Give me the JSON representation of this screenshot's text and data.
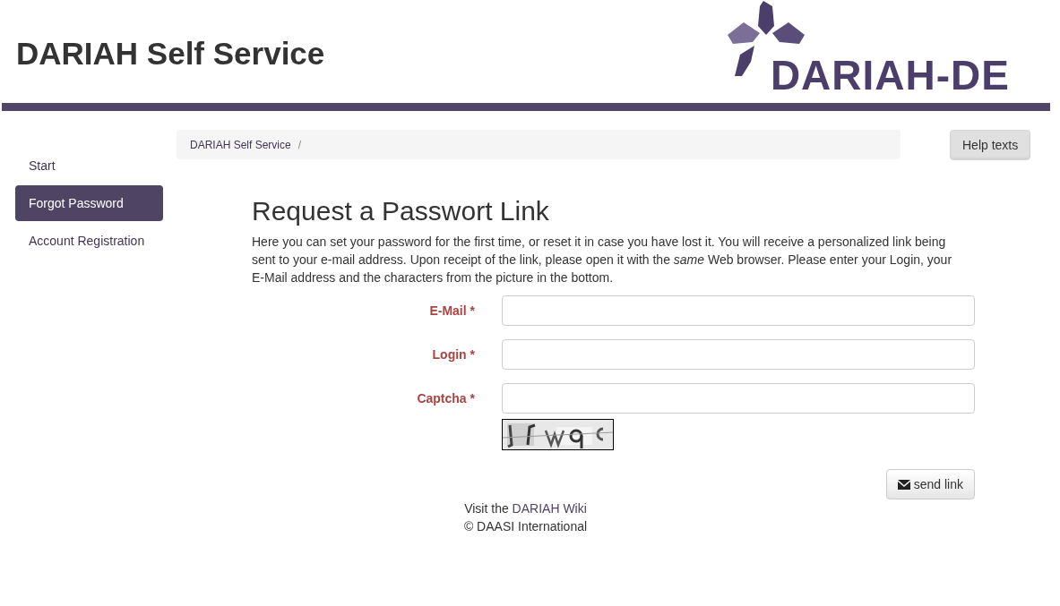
{
  "header": {
    "title": "DARIAH Self Service",
    "logo_text": "DARIAH-DE"
  },
  "sidebar": {
    "items": [
      {
        "label": "Start",
        "selected": false
      },
      {
        "label": "Forgot Password",
        "selected": true
      },
      {
        "label": "Account Registration",
        "selected": false
      }
    ]
  },
  "breadcrumb": [
    "DARIAH Self Service"
  ],
  "breadcrumb_separator": "/",
  "help_button": "Help texts",
  "heading": "Request a Passwort Link",
  "intro": "Here you can set your password for the first time, or reset it in case you have lost it. You will receive a personalized link being sent to your e-mail address. Upon receipt of the link, please open it with the *same* Web browser. Please enter your Login, your E-Mail address and the characters from the picture in the bottom.",
  "form": {
    "fields": [
      {
        "label": "E-Mail",
        "required_mark": "*"
      },
      {
        "label": "Login",
        "required_mark": "*"
      },
      {
        "label": "Captcha",
        "required_mark": "*"
      }
    ],
    "submit": "send link"
  },
  "footer": {
    "visit_text": "Visit the",
    "wiki_link": "DARIAH Wiki",
    "copyright": "© DAASI International"
  }
}
